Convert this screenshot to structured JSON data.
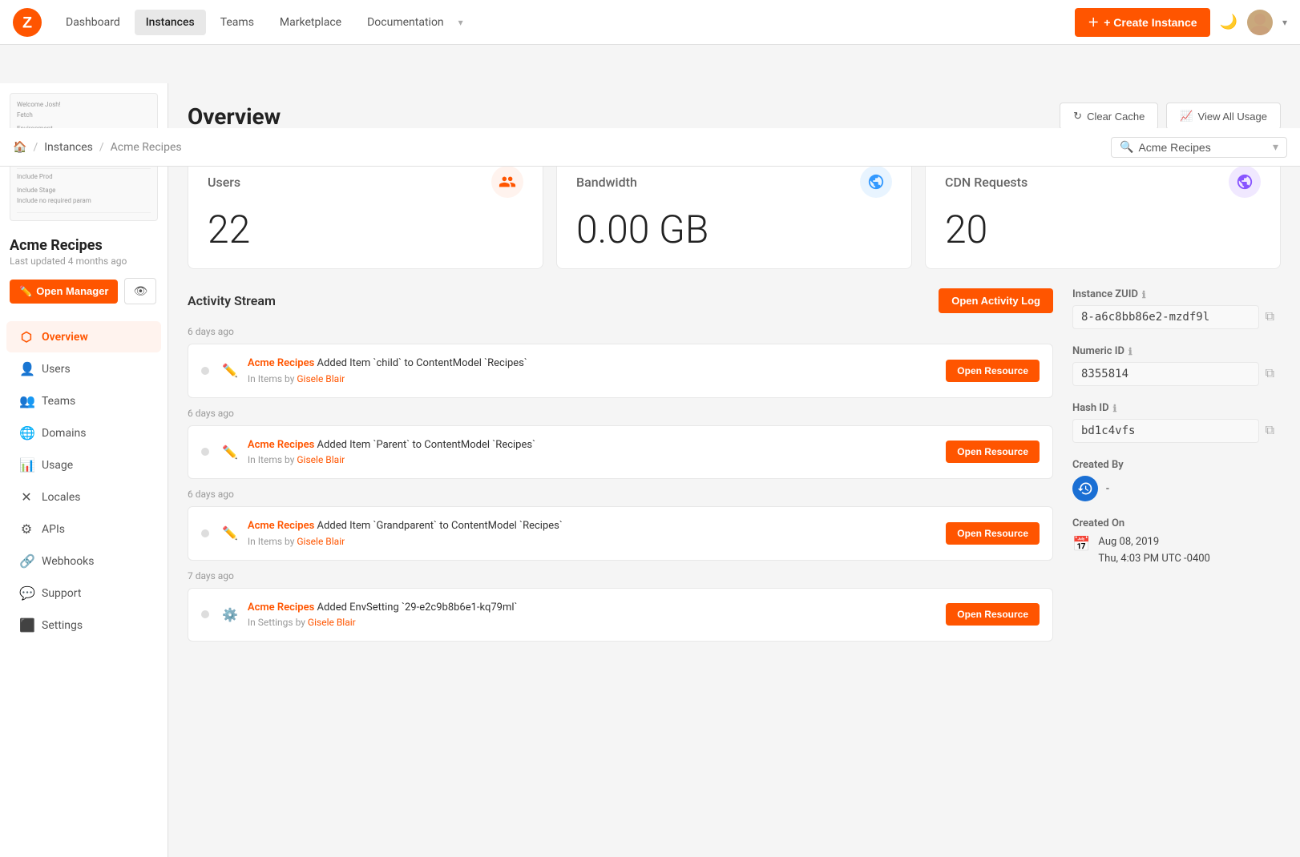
{
  "nav": {
    "links": [
      {
        "label": "Dashboard",
        "active": false
      },
      {
        "label": "Instances",
        "active": true
      },
      {
        "label": "Teams",
        "active": false
      },
      {
        "label": "Marketplace",
        "active": false
      },
      {
        "label": "Documentation",
        "active": false,
        "hasDropdown": true
      }
    ],
    "create_button": "+ Create Instance"
  },
  "breadcrumb": {
    "home": "🏠",
    "sep1": "/",
    "instances": "Instances",
    "sep2": "/",
    "current": "Acme Recipes",
    "search_value": "Acme Recipes"
  },
  "sidebar": {
    "instance_name": "Acme Recipes",
    "last_updated": "Last updated 4 months ago",
    "open_manager": "Open Manager",
    "nav_items": [
      {
        "label": "Overview",
        "icon": "📊",
        "active": true
      },
      {
        "label": "Users",
        "icon": "👤",
        "active": false
      },
      {
        "label": "Teams",
        "icon": "👥",
        "active": false
      },
      {
        "label": "Domains",
        "icon": "🌐",
        "active": false
      },
      {
        "label": "Usage",
        "icon": "📈",
        "active": false
      },
      {
        "label": "Locales",
        "icon": "✕",
        "active": false
      },
      {
        "label": "APIs",
        "icon": "⚙",
        "active": false
      },
      {
        "label": "Webhooks",
        "icon": "🔗",
        "active": false
      },
      {
        "label": "Support",
        "icon": "💬",
        "active": false
      },
      {
        "label": "Settings",
        "icon": "⬛",
        "active": false
      }
    ]
  },
  "overview": {
    "title": "Overview",
    "clear_cache": "Clear Cache",
    "view_all_usage": "View All Usage",
    "stats": [
      {
        "label": "Users",
        "value": "22",
        "icon_type": "users"
      },
      {
        "label": "Bandwidth",
        "value": "0.00 GB",
        "icon_type": "bandwidth"
      },
      {
        "label": "CDN Requests",
        "value": "20",
        "icon_type": "cdn"
      }
    ]
  },
  "activity": {
    "title": "Activity Stream",
    "open_log_btn": "Open Activity Log",
    "items": [
      {
        "time": "6 days ago",
        "instance": "Acme Recipes",
        "action": " Added Item `child` to ContentModel `Recipes`",
        "sub": "In Items by ",
        "user": "Gisele Blair",
        "btn": "Open Resource"
      },
      {
        "time": "6 days ago",
        "instance": "Acme Recipes",
        "action": " Added Item `Parent` to ContentModel `Recipes`",
        "sub": "In Items by ",
        "user": "Gisele Blair",
        "btn": "Open Resource"
      },
      {
        "time": "6 days ago",
        "instance": "Acme Recipes",
        "action": " Added Item `Grandparent` to ContentModel `Recipes`",
        "sub": "In Items by ",
        "user": "Gisele Blair",
        "btn": "Open Resource"
      },
      {
        "time": "7 days ago",
        "instance": "Acme Recipes",
        "action": " Added EnvSetting `29-e2c9b8b6e1-kq79ml`",
        "sub": "In Settings by ",
        "user": "Gisele Blair",
        "btn": "Open Resource"
      }
    ]
  },
  "info_panel": {
    "instance_zuid_label": "Instance ZUID",
    "instance_zuid_value": "8-a6c8bb86e2-mzdf9l",
    "numeric_id_label": "Numeric ID",
    "numeric_id_value": "8355814",
    "hash_id_label": "Hash ID",
    "hash_id_value": "bd1c4vfs",
    "created_by_label": "Created By",
    "created_by_dash": "-",
    "created_on_label": "Created On",
    "created_on_date": "Aug 08, 2019",
    "created_on_day": "Thu, 4:03 PM UTC -0400"
  }
}
